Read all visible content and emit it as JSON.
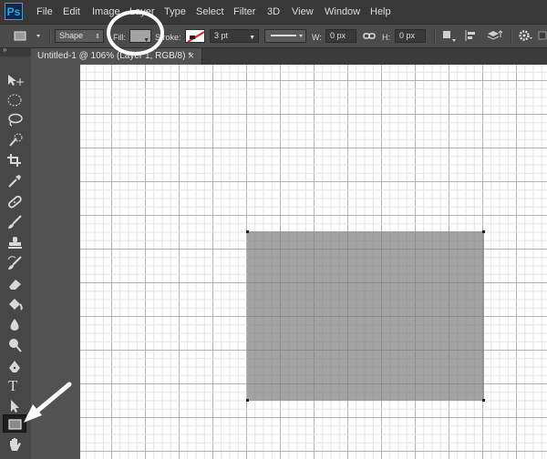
{
  "app": {
    "logo": "Ps"
  },
  "menu": [
    "File",
    "Edit",
    "Image",
    "Layer",
    "Type",
    "Select",
    "Filter",
    "3D",
    "View",
    "Window",
    "Help"
  ],
  "options": {
    "mode": "Shape",
    "fill_label": "Fill:",
    "fill_color": "#a3a3a3",
    "stroke_label": "Stroke:",
    "stroke_width": "3 pt",
    "w_label": "W:",
    "w_value": "0 px",
    "h_label": "H:",
    "h_value": "0 px"
  },
  "document": {
    "tab_label": "Untitled-1 @ 106% (Layer 1, RGB/8) *",
    "close": "×"
  },
  "canvas": {
    "background": "#ffffff",
    "grid_minor_color": "#e3e3e3",
    "grid_major_color": "#b3b3b3",
    "shape_fill": "#a3a3a3"
  },
  "toolbar": {
    "tools": [
      "move-tool",
      "marquee-tool",
      "lasso-tool",
      "quick-selection-tool",
      "crop-tool",
      "eyedropper-tool",
      "healing-brush-tool",
      "brush-tool",
      "clone-stamp-tool",
      "history-brush-tool",
      "eraser-tool",
      "paint-bucket-tool",
      "blur-tool",
      "dodge-tool",
      "pen-tool",
      "type-tool",
      "path-selection-tool",
      "rectangle-tool",
      "hand-tool"
    ],
    "type_glyph": "T"
  }
}
